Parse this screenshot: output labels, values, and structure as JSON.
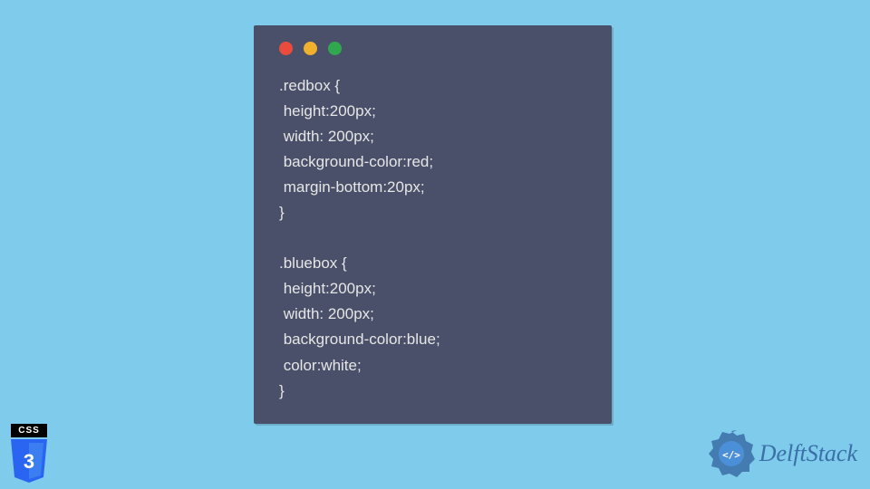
{
  "code_window": {
    "lines": [
      ".redbox {",
      " height:200px;",
      " width: 200px;",
      " background-color:red;",
      " margin-bottom:20px;",
      "}",
      "",
      ".bluebox {",
      " height:200px;",
      " width: 200px;",
      " background-color:blue;",
      " color:white;",
      "}"
    ]
  },
  "css_badge": {
    "label": "CSS",
    "version": "3"
  },
  "brand": {
    "name": "DelftStack"
  },
  "colors": {
    "page_bg": "#7ecbeb",
    "window_bg": "#4a5069",
    "code_text": "#e6e6e6",
    "dot_red": "#e94b3c",
    "dot_yellow": "#f1b12c",
    "dot_green": "#2fa84f",
    "css_shield": "#2965f1",
    "brand_blue": "#3a6fa8"
  }
}
